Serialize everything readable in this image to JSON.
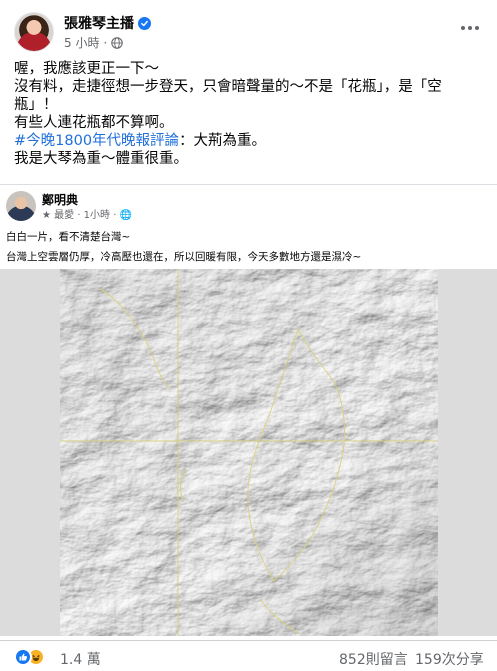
{
  "post": {
    "author": "張雅琴主播",
    "time": "5 小時",
    "separator": "·",
    "text_lines": [
      "喔，我應該更正一下～",
      "沒有料，走捷徑想一步登天，只會暗聲量的～不是「花瓶」，是「空",
      "瓶」！",
      "有些人連花瓶都不算啊。"
    ],
    "hashtag": "#今晚1800年代晚報評論",
    "hashtag_suffix": "：大荊為重。",
    "last_line": "我是大琴為重～體重很重。"
  },
  "embed": {
    "author": "鄭明典",
    "meta": "★ 最愛 · 1小時 · 🌐",
    "line1": "白白一片，看不清楚台灣~",
    "line2": "台灣上空雲層仍厚，冷高壓也還在，所以回暖有限，今天多數地方還是濕冷~"
  },
  "reactions": {
    "count": "1.4 萬",
    "comments": "852則留言",
    "shares": "159次分享"
  },
  "colors": {
    "link": "#216fdb",
    "secondary_text": "#65676b",
    "like_blue": "#1877f2",
    "haha_yellow": "#f7b125"
  },
  "icons": [
    "verified-badge-icon",
    "globe-icon",
    "more-options-icon",
    "like-reaction-icon",
    "haha-reaction-icon"
  ]
}
